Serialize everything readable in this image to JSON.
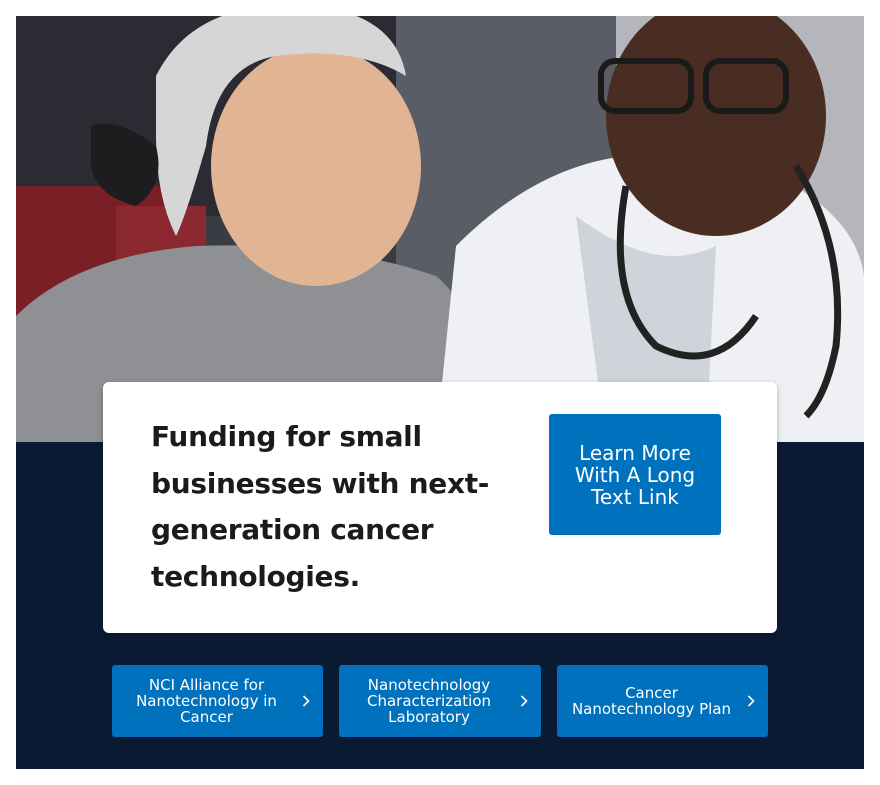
{
  "hero": {
    "image_alt": "Smiling patient wearing a head scarf with a doctor in a white coat and stethoscope",
    "card": {
      "title": "Funding for small businesses with next-generation cancer technologies.",
      "cta_label": "Learn More With A Long Text Link"
    }
  },
  "links": [
    {
      "label": "NCI Alliance for Nanotechnology in Cancer",
      "icon": "chevron-right-icon"
    },
    {
      "label": "Nanotechnology Characterization Laboratory",
      "icon": "chevron-right-icon"
    },
    {
      "label": "Cancer Nanotechnology Plan",
      "icon": "chevron-right-icon"
    }
  ],
  "colors": {
    "panel_bg": "#0b1a33",
    "button_bg": "#0071bc",
    "button_text": "#ffffff",
    "card_bg": "#ffffff",
    "title_text": "#1b1b1b"
  }
}
